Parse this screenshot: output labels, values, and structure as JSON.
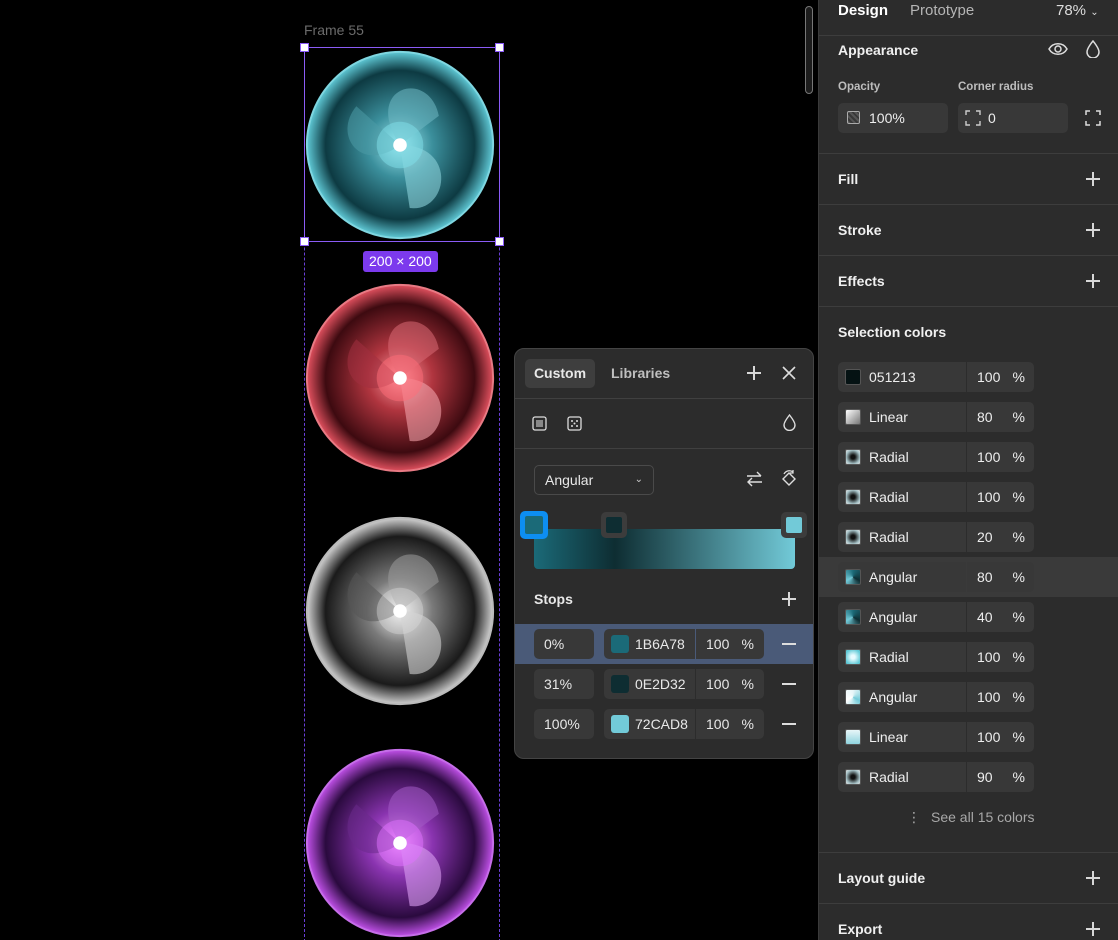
{
  "canvas": {
    "frame_label": "Frame 55",
    "size_badge": "200 × 200",
    "orbs": [
      {
        "name": "cyan",
        "color": "#5fc9d6",
        "dark": "#0d3a42"
      },
      {
        "name": "red",
        "color": "#e0505e",
        "dark": "#3d0a10"
      },
      {
        "name": "gray",
        "color": "#d0d0d0",
        "dark": "#1a1a1a"
      },
      {
        "name": "purple",
        "color": "#c050e8",
        "dark": "#2a0a3e"
      }
    ]
  },
  "panel": {
    "tabs": {
      "design": "Design",
      "prototype": "Prototype",
      "zoom": "78%"
    },
    "appearance": {
      "title": "Appearance",
      "opacity_label": "Opacity",
      "opacity_value": "100%",
      "radius_label": "Corner radius",
      "radius_value": "0"
    },
    "fill_title": "Fill",
    "stroke_title": "Stroke",
    "effects_title": "Effects",
    "selection_colors": {
      "title": "Selection colors",
      "items": [
        {
          "label": "051213",
          "opacity": "100",
          "pct": "%",
          "swatch": "#051213"
        },
        {
          "label": "Linear",
          "opacity": "80",
          "pct": "%",
          "swatch": "linear"
        },
        {
          "label": "Radial",
          "opacity": "100",
          "pct": "%",
          "swatch": "radial"
        },
        {
          "label": "Radial",
          "opacity": "100",
          "pct": "%",
          "swatch": "radial"
        },
        {
          "label": "Radial",
          "opacity": "20",
          "pct": "%",
          "swatch": "radial"
        },
        {
          "label": "Angular",
          "opacity": "80",
          "pct": "%",
          "swatch": "angular"
        },
        {
          "label": "Angular",
          "opacity": "40",
          "pct": "%",
          "swatch": "angular"
        },
        {
          "label": "Radial",
          "opacity": "100",
          "pct": "%",
          "swatch": "radial-cyan"
        },
        {
          "label": "Angular",
          "opacity": "100",
          "pct": "%",
          "swatch": "angular-light"
        },
        {
          "label": "Linear",
          "opacity": "100",
          "pct": "%",
          "swatch": "linear-cyan"
        },
        {
          "label": "Radial",
          "opacity": "90",
          "pct": "%",
          "swatch": "radial"
        }
      ],
      "see_all": "See all 15 colors"
    },
    "layout_guide_title": "Layout guide",
    "export_title": "Export"
  },
  "picker": {
    "tab_custom": "Custom",
    "tab_libraries": "Libraries",
    "gradient_type": "Angular",
    "stops_title": "Stops",
    "stops": [
      {
        "position": "0%",
        "hex": "1B6A78",
        "opacity": "100",
        "pct": "%",
        "color": "#1b6a78"
      },
      {
        "position": "31%",
        "hex": "0E2D32",
        "opacity": "100",
        "pct": "%",
        "color": "#0e2d32"
      },
      {
        "position": "100%",
        "hex": "72CAD8",
        "opacity": "100",
        "pct": "%",
        "color": "#72cad8"
      }
    ]
  }
}
